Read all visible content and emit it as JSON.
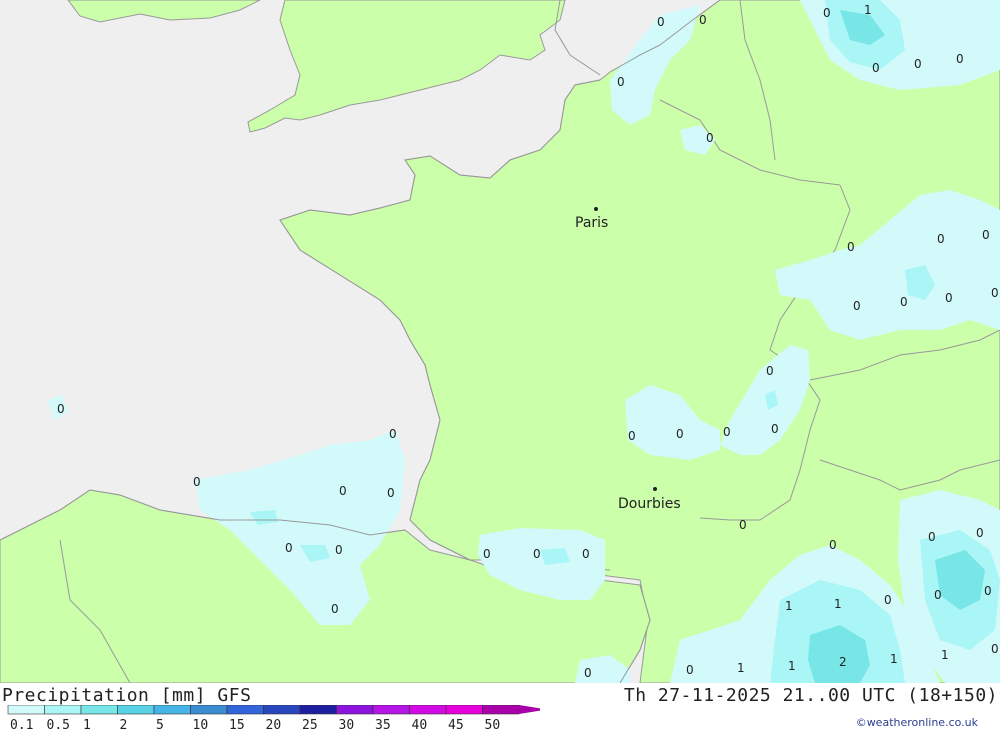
{
  "footer": {
    "left_title": "Precipitation [mm] GFS",
    "right_title": "Th 27-11-2025 21..00 UTC (18+150)",
    "credit": "©weatheronline.co.uk"
  },
  "legend": {
    "labels": [
      "0.1",
      "0.5",
      "1",
      "2",
      "5",
      "10",
      "15",
      "20",
      "25",
      "30",
      "35",
      "40",
      "45",
      "50"
    ],
    "colors": [
      "#d2fafa",
      "#aaf5f5",
      "#78e6e6",
      "#5ad2e6",
      "#46b4e6",
      "#3c8cd2",
      "#3264dc",
      "#2846be",
      "#1e1ea0",
      "#8c14dc",
      "#b414e6",
      "#d20ae6",
      "#e600dc",
      "#aa00aa"
    ]
  },
  "cities": [
    {
      "name": "Paris"
    },
    {
      "name": "Dourbies"
    }
  ],
  "value_labels": [
    "0",
    "0",
    "1",
    "0",
    "0",
    "0",
    "0",
    "0",
    "0",
    "0",
    "0",
    "0",
    "0",
    "0",
    "0",
    "0",
    "0",
    "0",
    "0",
    "0",
    "0",
    "0",
    "0",
    "0",
    "0",
    "0",
    "0",
    "0",
    "0",
    "0",
    "0",
    "0",
    "0",
    "0",
    "0",
    "1",
    "1",
    "0",
    "0",
    "0",
    "0",
    "1",
    "1",
    "2",
    "1",
    "1",
    "0",
    "0",
    "0"
  ],
  "colors": {
    "land": "#ccffaa",
    "sea": "#efefef",
    "border": "#999999",
    "precip_light": "#d2fafa",
    "precip_mid": "#aaf5f5",
    "precip_strong": "#78e6e6"
  }
}
